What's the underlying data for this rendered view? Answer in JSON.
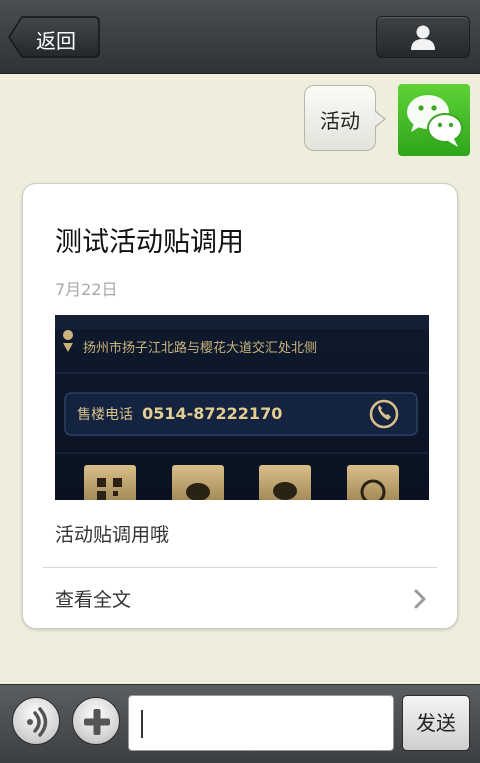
{
  "header": {
    "back_label": "返回",
    "back_icon": "arrow-left-icon",
    "profile_icon": "person-icon"
  },
  "message": {
    "text": "活动",
    "avatar_icon": "wechat-logo"
  },
  "article": {
    "title": "测试活动贴调用",
    "date": "7月22日",
    "image": {
      "address": "扬州市扬子江北路与樱花大道交汇处北侧",
      "phone_label": "售楼电话",
      "phone_number": "0514-87222170"
    },
    "description": "活动贴调用哦",
    "read_more_label": "查看全文"
  },
  "input_bar": {
    "voice_icon": "voice-icon",
    "plus_icon": "plus-icon",
    "input_value": "",
    "send_label": "发送"
  }
}
